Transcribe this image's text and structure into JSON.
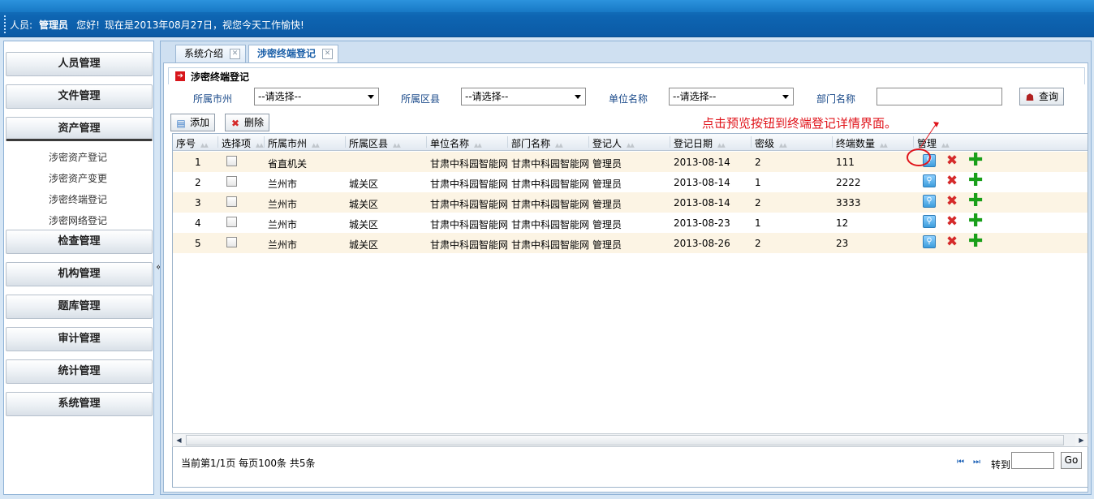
{
  "header": {
    "user_label": "人员:",
    "user_name": "管理员",
    "greeting": "您好!",
    "date_message": "现在是2013年08月27日，视您今天工作愉快!"
  },
  "sidebar": {
    "groups": [
      {
        "label": "人员管理"
      },
      {
        "label": "文件管理"
      },
      {
        "label": "资产管理"
      },
      {
        "label": "检查管理"
      },
      {
        "label": "机构管理"
      },
      {
        "label": "题库管理"
      },
      {
        "label": "审计管理"
      },
      {
        "label": "统计管理"
      },
      {
        "label": "系统管理"
      }
    ],
    "asset_subitems": [
      {
        "label": "涉密资产登记"
      },
      {
        "label": "涉密资产变更"
      },
      {
        "label": "涉密终端登记"
      },
      {
        "label": "涉密网络登记"
      }
    ],
    "collapse_glyph": "«"
  },
  "tabs": [
    {
      "label": "系统介绍"
    },
    {
      "label": "涉密终端登记"
    }
  ],
  "panel": {
    "title": "涉密终端登记"
  },
  "filters": {
    "city_label": "所属市州",
    "city_value": "--请选择--",
    "district_label": "所属区县",
    "district_value": "--请选择--",
    "unit_label": "单位名称",
    "unit_value": "--请选择--",
    "dept_label": "部门名称",
    "dept_value": "",
    "query_label": "查询"
  },
  "toolbar": {
    "add_label": "添加",
    "delete_label": "删除"
  },
  "annotation": "点击预览按钮到终端登记详情界面。",
  "table": {
    "columns": [
      "序号",
      "选择项",
      "所属市州",
      "所属区县",
      "单位名称",
      "部门名称",
      "登记人",
      "登记日期",
      "密级",
      "终端数量",
      "管理"
    ],
    "rows": [
      {
        "no": "1",
        "city": "省直机关",
        "district": "",
        "unit": "甘肃中科园智能网",
        "dept": "甘肃中科园智能网",
        "registrar": "管理员",
        "date": "2013-08-14",
        "level": "2",
        "count": "111"
      },
      {
        "no": "2",
        "city": "兰州市",
        "district": "城关区",
        "unit": "甘肃中科园智能网",
        "dept": "甘肃中科园智能网",
        "registrar": "管理员",
        "date": "2013-08-14",
        "level": "1",
        "count": "2222"
      },
      {
        "no": "3",
        "city": "兰州市",
        "district": "城关区",
        "unit": "甘肃中科园智能网",
        "dept": "甘肃中科园智能网",
        "registrar": "管理员",
        "date": "2013-08-14",
        "level": "2",
        "count": "3333"
      },
      {
        "no": "4",
        "city": "兰州市",
        "district": "城关区",
        "unit": "甘肃中科园智能网",
        "dept": "甘肃中科园智能网",
        "registrar": "管理员",
        "date": "2013-08-23",
        "level": "1",
        "count": "12"
      },
      {
        "no": "5",
        "city": "兰州市",
        "district": "城关区",
        "unit": "甘肃中科园智能网",
        "dept": "甘肃中科园智能网",
        "registrar": "管理员",
        "date": "2013-08-26",
        "level": "2",
        "count": "23"
      }
    ]
  },
  "pager": {
    "info": "当前第1/1页  每页100条  共5条",
    "goto_label": "转到",
    "go_label": "Go"
  },
  "colors": {
    "header_blue": "#0e65b2",
    "annotation_red": "#e0141b",
    "row_stripe": "#fcf4e4",
    "add_green": "#1a9f1a",
    "delete_red": "#d52a2a"
  }
}
